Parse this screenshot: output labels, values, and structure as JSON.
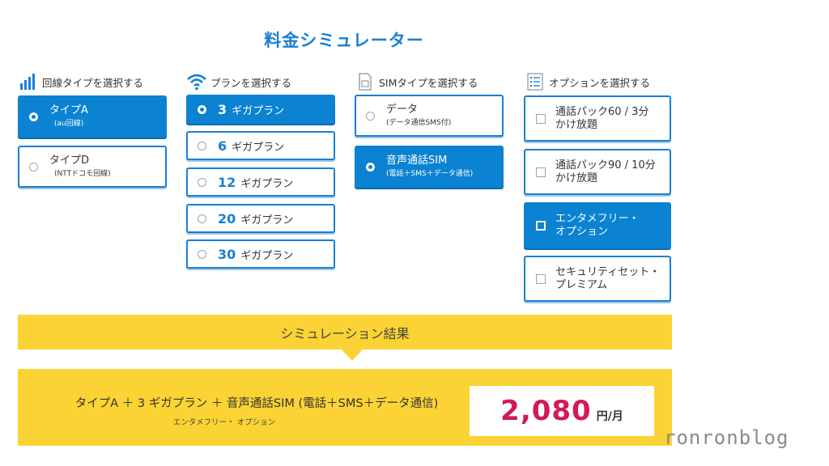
{
  "title": "料金シミュレーター",
  "columns": {
    "line": {
      "header": "回線タイプを選択する",
      "icon": "signal-bars-icon",
      "options": [
        {
          "label": "タイプA",
          "sub": "(au回線)",
          "selected": true
        },
        {
          "label": "タイプD",
          "sub": "(NTTドコモ回線)",
          "selected": false
        }
      ]
    },
    "plan": {
      "header": "プランを選択する",
      "icon": "wifi-icon",
      "unit": "ギガプラン",
      "options": [
        {
          "num": "3",
          "selected": true
        },
        {
          "num": "6",
          "selected": false
        },
        {
          "num": "12",
          "selected": false
        },
        {
          "num": "20",
          "selected": false
        },
        {
          "num": "30",
          "selected": false
        }
      ]
    },
    "sim": {
      "header": "SIMタイプを選択する",
      "icon": "sim-card-icon",
      "options": [
        {
          "label": "データ",
          "sub": "(データ通信SMS付)",
          "selected": false
        },
        {
          "label": "音声通話SIM",
          "sub": "(電話＋SMS＋データ通信)",
          "selected": true
        }
      ]
    },
    "option": {
      "header": "オプションを選択する",
      "icon": "checklist-icon",
      "options": [
        {
          "line1": "通話パック60 / 3分",
          "line2": "かけ放題",
          "selected": false
        },
        {
          "line1": "通話パック90 / 10分",
          "line2": "かけ放題",
          "selected": false
        },
        {
          "line1": "エンタメフリー・",
          "line2": "オプション",
          "selected": true
        },
        {
          "line1": "セキュリティセット・",
          "line2": "プレミアム",
          "selected": false
        }
      ]
    }
  },
  "result": {
    "heading": "シミュレーション結果",
    "summary": "タイプA ＋ 3 ギガプラン ＋ 音声通話SIM (電話＋SMS＋データ通信)",
    "option": "エンタメフリー・ オプション",
    "price": "2,080",
    "unit": "円/月"
  },
  "watermark": "ronronblog",
  "colors": {
    "accent": "#0b82d2",
    "result_bg": "#fbd334",
    "price": "#d3185a"
  }
}
